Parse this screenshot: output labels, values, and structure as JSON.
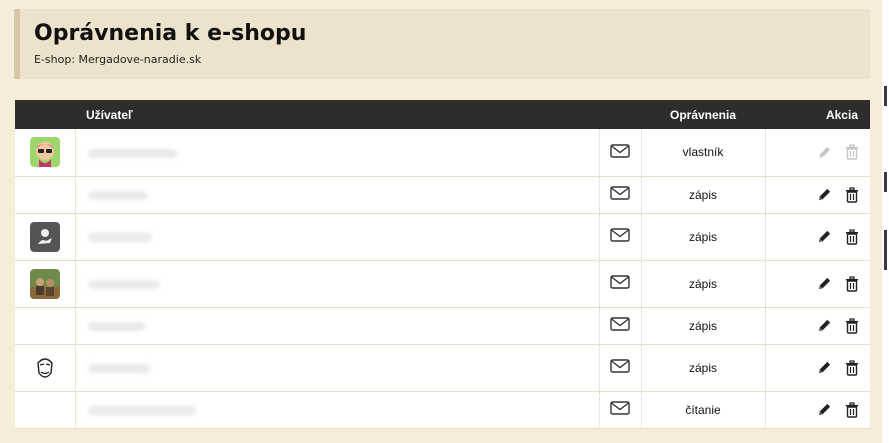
{
  "page": {
    "title": "Oprávnenia k e-shopu",
    "shop_label": "E-shop: Mergadove-naradie.sk"
  },
  "table": {
    "headers": {
      "user": "Užívateľ",
      "permission": "Oprávnenia",
      "action": "Akcia"
    },
    "rows": [
      {
        "avatar": "avatar-cartoon-sunglasses",
        "permission": "vlastník",
        "actions_enabled": false
      },
      {
        "avatar": "none",
        "permission": "zápis",
        "actions_enabled": true
      },
      {
        "avatar": "avatar-dark-icon",
        "permission": "zápis",
        "actions_enabled": true
      },
      {
        "avatar": "avatar-photo-outdoor",
        "permission": "zápis",
        "actions_enabled": true
      },
      {
        "avatar": "none",
        "permission": "zápis",
        "actions_enabled": true
      },
      {
        "avatar": "avatar-meme-face",
        "permission": "zápis",
        "actions_enabled": true
      },
      {
        "avatar": "none",
        "permission": "čítanie",
        "actions_enabled": true
      }
    ]
  },
  "icons": {
    "mail": "envelope-icon",
    "edit": "pencil-icon",
    "delete": "trash-icon"
  },
  "colors": {
    "page_bg": "#f5ecd9",
    "header_bg": "#ede3cc",
    "table_head_bg": "#2d2d2d"
  }
}
